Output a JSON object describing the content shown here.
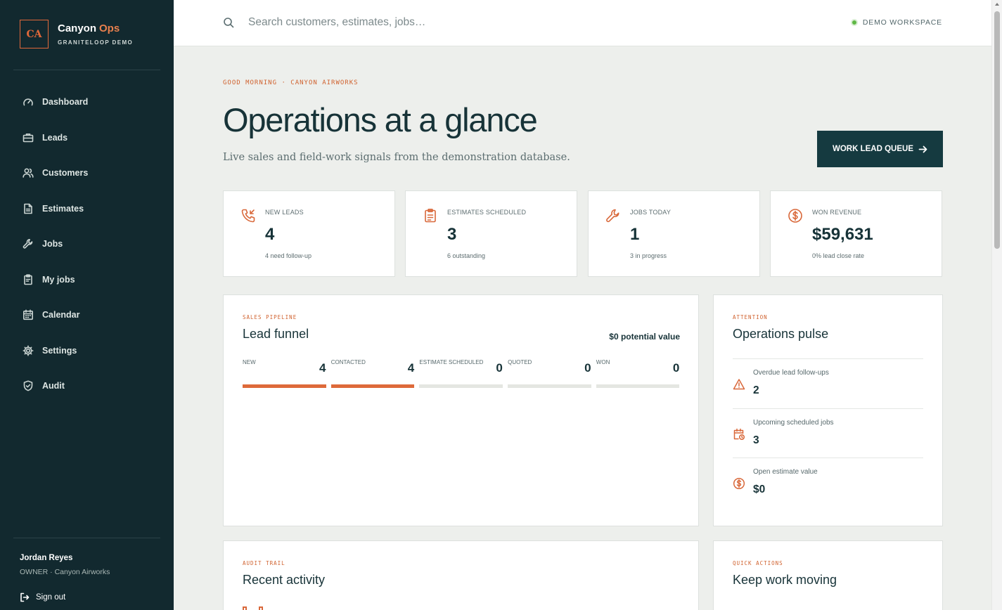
{
  "sidebar": {
    "brand_mark": "CA",
    "brand_name": "Canyon",
    "brand_accent": "Ops",
    "brand_sub": "GRANITELOOP DEMO",
    "nav": [
      {
        "label": "Dashboard",
        "icon": "gauge-icon"
      },
      {
        "label": "Leads",
        "icon": "briefcase-icon"
      },
      {
        "label": "Customers",
        "icon": "users-icon"
      },
      {
        "label": "Estimates",
        "icon": "document-icon"
      },
      {
        "label": "Jobs",
        "icon": "wrench-icon"
      },
      {
        "label": "My jobs",
        "icon": "clipboard-icon"
      },
      {
        "label": "Calendar",
        "icon": "calendar-icon"
      },
      {
        "label": "Settings",
        "icon": "gear-icon"
      },
      {
        "label": "Audit",
        "icon": "shield-check-icon"
      }
    ],
    "user": {
      "name": "Jordan Reyes",
      "role": "OWNER · Canyon Airworks"
    },
    "signout_label": "Sign out"
  },
  "topbar": {
    "search_placeholder": "Search customers, estimates, jobs…",
    "workspace_label": "DEMO WORKSPACE",
    "workspace_status_color": "#5fb845"
  },
  "header": {
    "eyebrow": "GOOD MORNING · CANYON AIRWORKS",
    "title": "Operations at a glance",
    "subtitle": "Live sales and field-work signals from the demonstration database.",
    "cta_label": "WORK LEAD QUEUE"
  },
  "stats": [
    {
      "label": "NEW LEADS",
      "value": "4",
      "note": "4 need follow-up",
      "icon": "phone-incoming-icon"
    },
    {
      "label": "ESTIMATES SCHEDULED",
      "value": "3",
      "note": "6 outstanding",
      "icon": "clipboard-list-icon"
    },
    {
      "label": "JOBS TODAY",
      "value": "1",
      "note": "3 in progress",
      "icon": "wrench-icon"
    },
    {
      "label": "WON REVENUE",
      "value": "$59,631",
      "note": "0% lead close rate",
      "icon": "dollar-circle-icon"
    }
  ],
  "pipeline": {
    "eyebrow": "SALES PIPELINE",
    "title": "Lead funnel",
    "potential_value": "$0 potential value",
    "max_count": 4,
    "stages": [
      {
        "label": "NEW",
        "count": 4
      },
      {
        "label": "CONTACTED",
        "count": 4
      },
      {
        "label": "ESTIMATE SCHEDULED",
        "count": 0
      },
      {
        "label": "QUOTED",
        "count": 0
      },
      {
        "label": "WON",
        "count": 0
      }
    ]
  },
  "pulse": {
    "eyebrow": "ATTENTION",
    "title": "Operations pulse",
    "items": [
      {
        "label": "Overdue lead follow-ups",
        "value": "2",
        "icon": "warning-triangle-icon"
      },
      {
        "label": "Upcoming scheduled jobs",
        "value": "3",
        "icon": "calendar-clock-icon"
      },
      {
        "label": "Open estimate value",
        "value": "$0",
        "icon": "dollar-circle-icon"
      }
    ]
  },
  "activity": {
    "eyebrow": "AUDIT TRAIL",
    "title": "Recent activity"
  },
  "quick_actions": {
    "eyebrow": "QUICK ACTIONS",
    "title": "Keep work moving"
  },
  "colors": {
    "sidebar": "#12292f",
    "accent": "#de6a3a",
    "primary": "#153a40",
    "background": "#edefec"
  }
}
